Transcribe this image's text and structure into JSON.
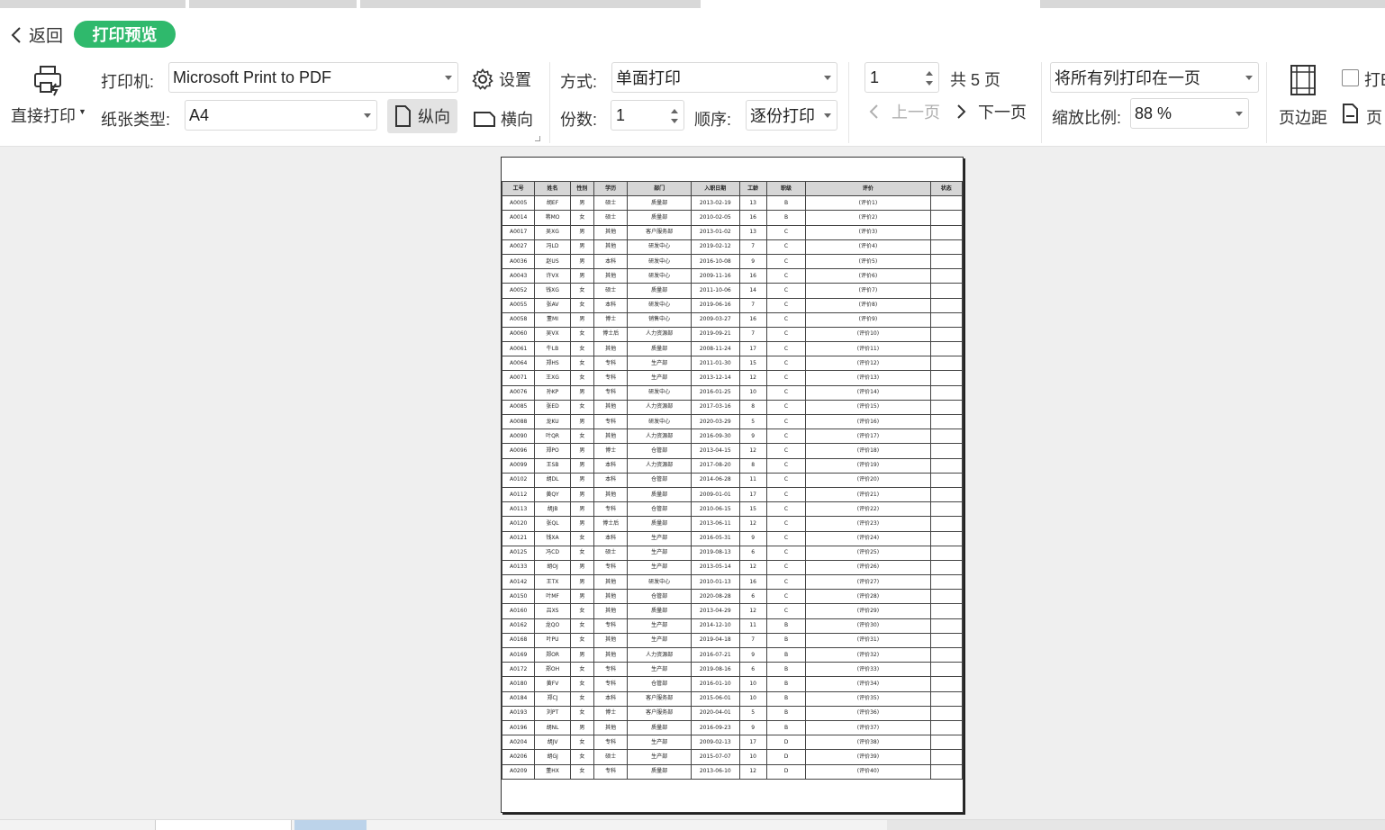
{
  "toolbar": {
    "back_label": "返回",
    "preview_label": "打印预览",
    "direct_print_label": "直接打印",
    "printer_label": "打印机:",
    "printer_value": "Microsoft Print to PDF",
    "settings_label": "设置",
    "paper_label": "纸张类型:",
    "paper_value": "A4",
    "portrait_label": "纵向",
    "landscape_label": "横向",
    "mode_label": "方式:",
    "mode_value": "单面打印",
    "copies_label": "份数:",
    "copies_value": "1",
    "order_label": "顺序:",
    "order_value": "逐份打印",
    "page_value": "1",
    "total_pages": "共 5 页",
    "prev_page": "上一页",
    "next_page": "下一页",
    "fit_value": "将所有列打印在一页",
    "scale_label": "缩放比例:",
    "scale_value": "88 %",
    "margin_label": "页边距",
    "extra1": "打E",
    "extra2": "页"
  },
  "sheet": {
    "headers": [
      "工号",
      "姓名",
      "性别",
      "学历",
      "部门",
      "入职日期",
      "工龄",
      "职级",
      "评价",
      "状态"
    ],
    "rows": [
      [
        "A0005",
        "胡EF",
        "男",
        "硕士",
        "质量部",
        "2013-02-19",
        "13",
        "B",
        "(评价1)",
        ""
      ],
      [
        "A0014",
        "蒋MO",
        "女",
        "硕士",
        "质量部",
        "2010-02-05",
        "16",
        "B",
        "(评价2)",
        ""
      ],
      [
        "A0017",
        "吴XG",
        "男",
        "其他",
        "客户服务部",
        "2013-01-02",
        "13",
        "C",
        "(评价3)",
        ""
      ],
      [
        "A0027",
        "冯LD",
        "男",
        "其他",
        "研发中心",
        "2019-02-12",
        "7",
        "C",
        "(评价4)",
        ""
      ],
      [
        "A0036",
        "赵US",
        "男",
        "本科",
        "研发中心",
        "2016-10-08",
        "9",
        "C",
        "(评价5)",
        ""
      ],
      [
        "A0043",
        "许VX",
        "男",
        "其他",
        "研发中心",
        "2009-11-16",
        "16",
        "C",
        "(评价6)",
        ""
      ],
      [
        "A0052",
        "钱XG",
        "女",
        "硕士",
        "质量部",
        "2011-10-06",
        "14",
        "C",
        "(评价7)",
        ""
      ],
      [
        "A0055",
        "张AV",
        "女",
        "本科",
        "研发中心",
        "2019-06-16",
        "7",
        "C",
        "(评价8)",
        ""
      ],
      [
        "A0058",
        "董MI",
        "男",
        "博士",
        "销售中心",
        "2009-03-27",
        "16",
        "C",
        "(评价9)",
        ""
      ],
      [
        "A0060",
        "吴VX",
        "女",
        "博士后",
        "人力资源部",
        "2019-09-21",
        "7",
        "C",
        "(评价10)",
        ""
      ],
      [
        "A0061",
        "牛LB",
        "女",
        "其他",
        "质量部",
        "2008-11-24",
        "17",
        "C",
        "(评价11)",
        ""
      ],
      [
        "A0064",
        "郑HS",
        "女",
        "专科",
        "生产部",
        "2011-01-30",
        "15",
        "C",
        "(评价12)",
        ""
      ],
      [
        "A0071",
        "王XG",
        "女",
        "专科",
        "生产部",
        "2013-12-14",
        "12",
        "C",
        "(评价13)",
        ""
      ],
      [
        "A0076",
        "孙KP",
        "男",
        "专科",
        "研发中心",
        "2016-01-25",
        "10",
        "C",
        "(评价14)",
        ""
      ],
      [
        "A0085",
        "张ED",
        "女",
        "其他",
        "人力资源部",
        "2017-03-16",
        "8",
        "C",
        "(评价15)",
        ""
      ],
      [
        "A0088",
        "龙KU",
        "男",
        "专科",
        "研发中心",
        "2020-03-29",
        "5",
        "C",
        "(评价16)",
        ""
      ],
      [
        "A0090",
        "叶QR",
        "女",
        "其他",
        "人力资源部",
        "2016-09-30",
        "9",
        "C",
        "(评价17)",
        ""
      ],
      [
        "A0096",
        "郑PO",
        "男",
        "博士",
        "仓管部",
        "2013-04-15",
        "12",
        "C",
        "(评价18)",
        ""
      ],
      [
        "A0099",
        "王SB",
        "男",
        "本科",
        "人力资源部",
        "2017-08-20",
        "8",
        "C",
        "(评价19)",
        ""
      ],
      [
        "A0102",
        "胡DL",
        "男",
        "本科",
        "仓管部",
        "2014-06-28",
        "11",
        "C",
        "(评价20)",
        ""
      ],
      [
        "A0112",
        "黄QY",
        "男",
        "其他",
        "质量部",
        "2009-01-01",
        "17",
        "C",
        "(评价21)",
        ""
      ],
      [
        "A0113",
        "胡JB",
        "男",
        "专科",
        "仓管部",
        "2010-06-15",
        "15",
        "C",
        "(评价22)",
        ""
      ],
      [
        "A0120",
        "张QL",
        "男",
        "博士后",
        "质量部",
        "2013-06-11",
        "12",
        "C",
        "(评价23)",
        ""
      ],
      [
        "A0121",
        "钱XA",
        "女",
        "本科",
        "生产部",
        "2016-05-31",
        "9",
        "C",
        "(评价24)",
        ""
      ],
      [
        "A0125",
        "冯CD",
        "女",
        "硕士",
        "生产部",
        "2019-08-13",
        "6",
        "C",
        "(评价25)",
        ""
      ],
      [
        "A0133",
        "胡OJ",
        "男",
        "专科",
        "生产部",
        "2013-05-14",
        "12",
        "C",
        "(评价26)",
        ""
      ],
      [
        "A0142",
        "王TX",
        "男",
        "其他",
        "研发中心",
        "2010-01-13",
        "16",
        "C",
        "(评价27)",
        ""
      ],
      [
        "A0150",
        "叶MF",
        "男",
        "其他",
        "仓管部",
        "2020-08-28",
        "6",
        "C",
        "(评价28)",
        ""
      ],
      [
        "A0160",
        "吕XS",
        "女",
        "其他",
        "质量部",
        "2013-04-29",
        "12",
        "C",
        "(评价29)",
        ""
      ],
      [
        "A0162",
        "龙QO",
        "女",
        "专科",
        "生产部",
        "2014-12-10",
        "11",
        "B",
        "(评价30)",
        ""
      ],
      [
        "A0168",
        "叶PU",
        "女",
        "其他",
        "生产部",
        "2019-04-18",
        "7",
        "B",
        "(评价31)",
        ""
      ],
      [
        "A0169",
        "郑OR",
        "男",
        "其他",
        "人力资源部",
        "2016-07-21",
        "9",
        "B",
        "(评价32)",
        ""
      ],
      [
        "A0172",
        "郑OH",
        "女",
        "专科",
        "生产部",
        "2019-08-16",
        "6",
        "B",
        "(评价33)",
        ""
      ],
      [
        "A0180",
        "黄FV",
        "女",
        "专科",
        "仓管部",
        "2016-01-10",
        "10",
        "B",
        "(评价34)",
        ""
      ],
      [
        "A0184",
        "郑CJ",
        "女",
        "本科",
        "客户服务部",
        "2015-06-01",
        "10",
        "B",
        "(评价35)",
        ""
      ],
      [
        "A0193",
        "刘PT",
        "女",
        "博士",
        "客户服务部",
        "2020-04-01",
        "5",
        "B",
        "(评价36)",
        ""
      ],
      [
        "A0196",
        "胡NL",
        "男",
        "其他",
        "质量部",
        "2016-09-23",
        "9",
        "B",
        "(评价37)",
        ""
      ],
      [
        "A0204",
        "胡JV",
        "女",
        "专科",
        "生产部",
        "2009-02-13",
        "17",
        "D",
        "(评价38)",
        ""
      ],
      [
        "A0206",
        "胡GJ",
        "女",
        "硕士",
        "生产部",
        "2015-07-07",
        "10",
        "D",
        "(评价39)",
        ""
      ],
      [
        "A0209",
        "董HX",
        "女",
        "专科",
        "质量部",
        "2013-06-10",
        "12",
        "D",
        "(评价40)",
        ""
      ]
    ]
  },
  "colors": {
    "accent": "#2fb96c",
    "header_fill": "#d6d6d6"
  }
}
